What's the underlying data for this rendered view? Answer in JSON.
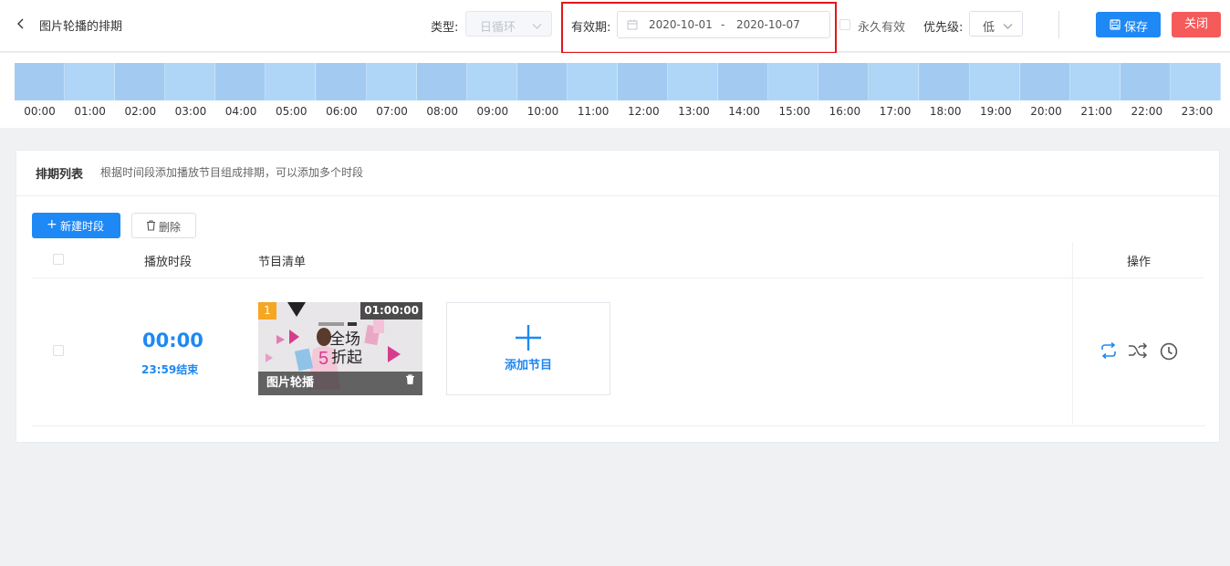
{
  "header": {
    "title": "图片轮播的排期",
    "type_label": "类型:",
    "type_value": "日循环",
    "valid_label": "有效期:",
    "start_date": "2020-10-01",
    "date_sep": "-",
    "end_date": "2020-10-07",
    "forever_label": "永久有效",
    "priority_label": "优先级:",
    "priority_value": "低",
    "save_label": "保存",
    "close_label": "关闭"
  },
  "timeline": {
    "hours": [
      "00:00",
      "01:00",
      "02:00",
      "03:00",
      "04:00",
      "05:00",
      "06:00",
      "07:00",
      "08:00",
      "09:00",
      "10:00",
      "11:00",
      "12:00",
      "13:00",
      "14:00",
      "15:00",
      "16:00",
      "17:00",
      "18:00",
      "19:00",
      "20:00",
      "21:00",
      "22:00",
      "23:00"
    ]
  },
  "schedule": {
    "title": "排期列表",
    "description": "根据时间段添加播放节目组成排期，可以添加多个时段",
    "new_label": "新建时段",
    "delete_label": "删除",
    "columns": {
      "period": "播放时段",
      "programs": "节目清单",
      "actions": "操作"
    },
    "rows": [
      {
        "start": "00:00",
        "end_text": "23:59结束",
        "program": {
          "index": "1",
          "duration": "01:00:00",
          "name": "图片轮播",
          "banner_main": "全场",
          "banner_num": "5",
          "banner_sub": "折起"
        }
      }
    ],
    "add_program_label": "添加节目"
  },
  "colors": {
    "primary": "#1e88f5",
    "danger": "#f55b5b",
    "timeline": "#a6cff5",
    "highlight": "#e0161b"
  }
}
